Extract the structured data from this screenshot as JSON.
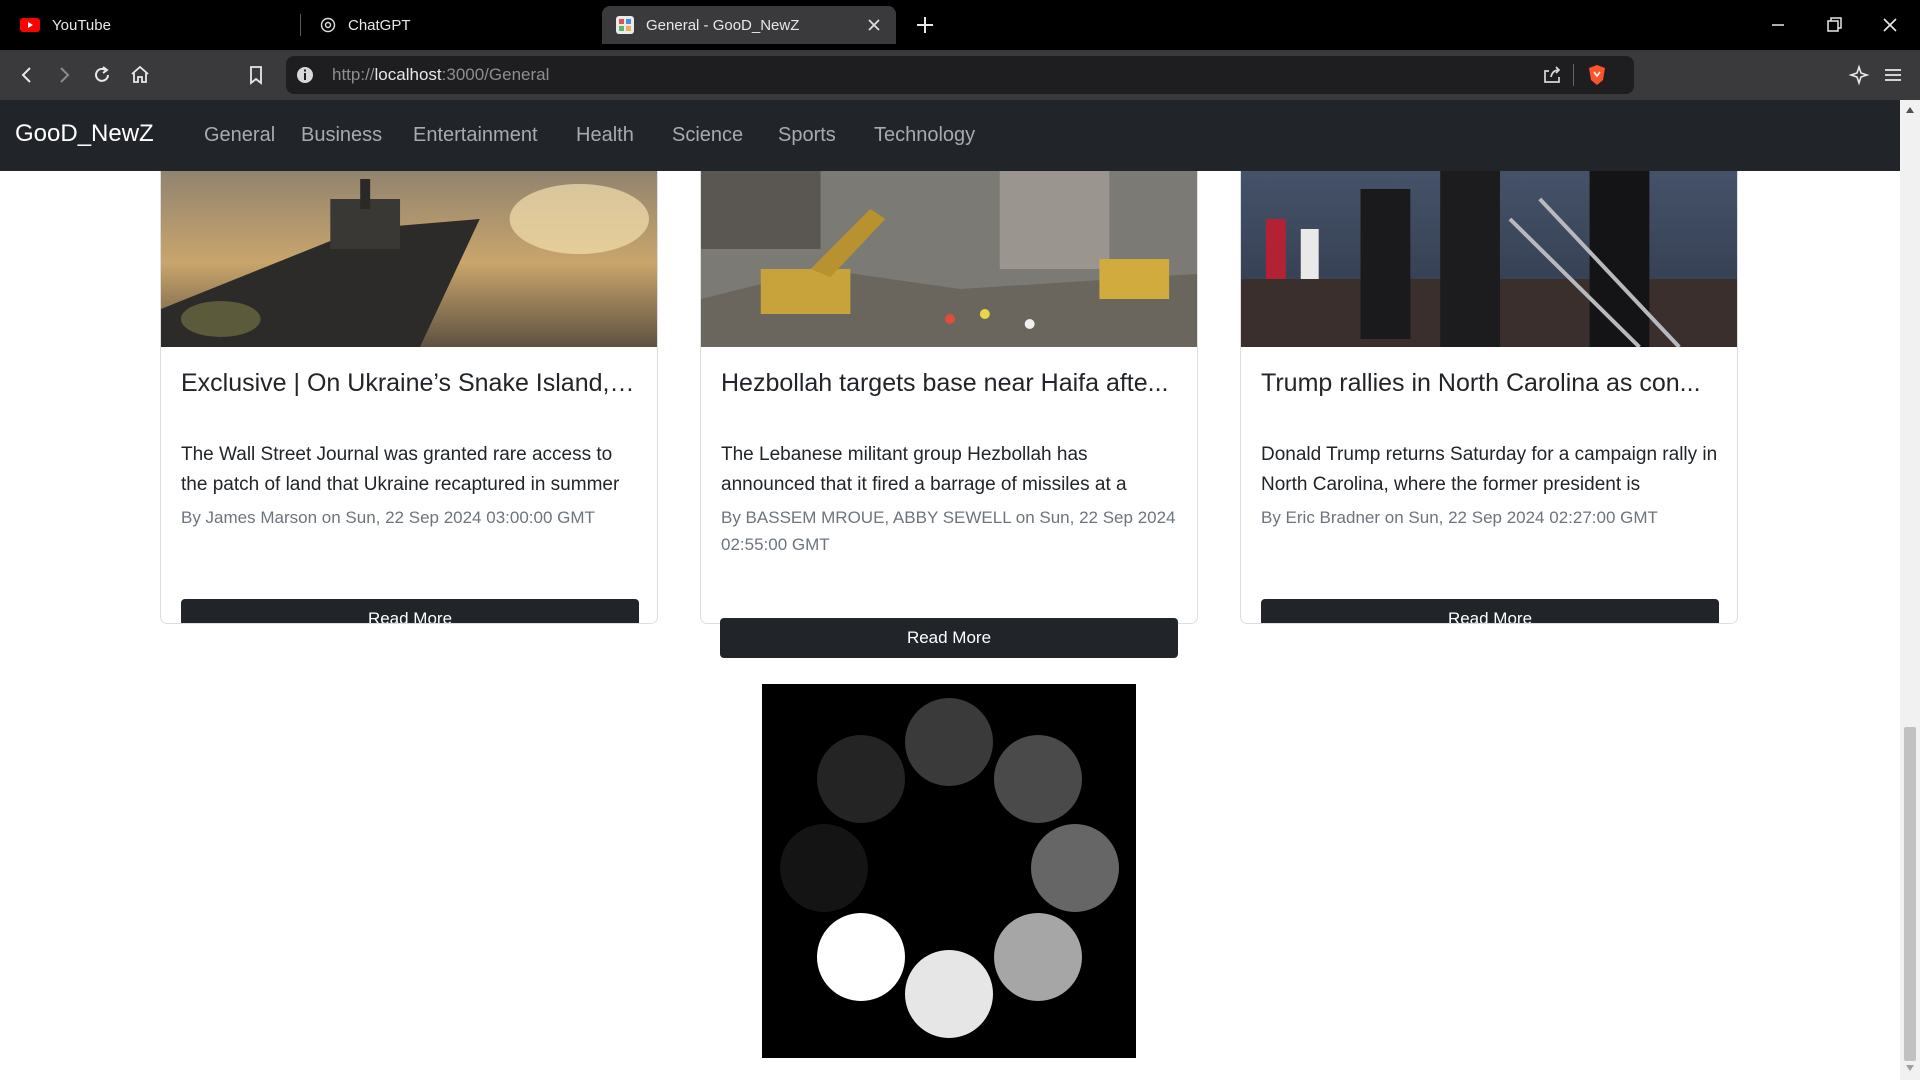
{
  "browser": {
    "tabs": [
      {
        "title": "YouTube",
        "icon": "youtube-icon"
      },
      {
        "title": "ChatGPT",
        "icon": "chatgpt-icon"
      },
      {
        "title": "General - GooD_NewZ",
        "icon": "site-favicon",
        "active": true
      }
    ],
    "url": {
      "scheme": "http://",
      "host": "localhost",
      "rest": ":3000/General"
    }
  },
  "navbar": {
    "brand": "GooD_NewZ",
    "links": [
      "General",
      "Business",
      "Entertainment",
      "Health",
      "Science",
      "Sports",
      "Technology"
    ]
  },
  "articles": [
    {
      "title": "Exclusive | On Ukraine’s Snake Island, ...",
      "description": "The Wall Street Journal was granted rare access to the patch of land that Ukraine recaptured in summer",
      "meta": "By James Marson on Sun, 22 Sep 2024 03:00:00 GMT",
      "button": "Read More"
    },
    {
      "title": "Hezbollah targets base near Haifa afte...",
      "description": "The Lebanese militant group Hezbollah has announced that it fired a barrage of missiles at a",
      "meta": "By BASSEM MROUE, ABBY SEWELL on Sun, 22 Sep 2024 02:55:00 GMT",
      "button": "Read More"
    },
    {
      "title": "Trump rallies in North Carolina as con...",
      "description": "Donald Trump returns Saturday for a campaign rally in North Carolina, where the former president is",
      "meta": "By Eric Bradner on Sun, 22 Sep 2024 02:27:00 GMT",
      "button": "Read More"
    }
  ],
  "colors": {
    "navbar_bg": "#212529",
    "button_bg": "#212529",
    "browser_toolbar": "#3a3a3c",
    "tab_strip": "#000000",
    "brave_shield": "#fb542b",
    "youtube_red": "#ff0000"
  }
}
